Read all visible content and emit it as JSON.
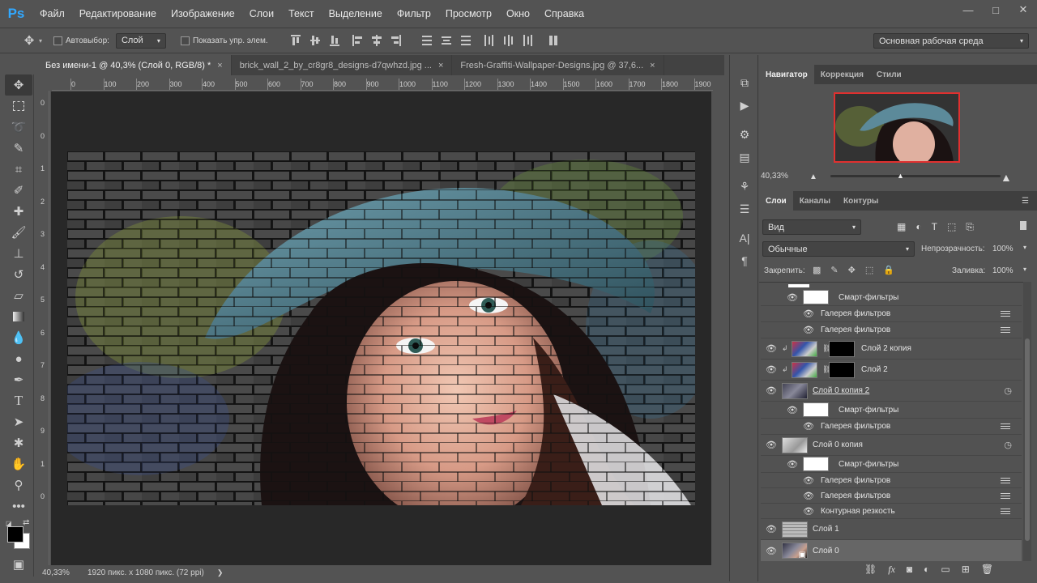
{
  "app": {
    "logo": "Ps"
  },
  "menu": [
    "Файл",
    "Редактирование",
    "Изображение",
    "Слои",
    "Текст",
    "Выделение",
    "Фильтр",
    "Просмотр",
    "Окно",
    "Справка"
  ],
  "window_controls": {
    "minimize": "—",
    "restore": "□",
    "close": "✕"
  },
  "options": {
    "autoselect_label": "Автовыбор:",
    "autoselect_value": "Слой",
    "show_controls_label": "Показать упр. элем.",
    "workspace": "Основная рабочая среда"
  },
  "doc_tabs": [
    {
      "label": "Без имени-1 @ 40,3% (Слой 0, RGB/8) *",
      "close": "×"
    },
    {
      "label": "brick_wall_2_by_cr8gr8_designs-d7qwhzd.jpg ...",
      "close": "×"
    },
    {
      "label": "Fresh-Graffiti-Wallpaper-Designs.jpg @ 37,6...",
      "close": "×"
    }
  ],
  "ruler": {
    "h_labels": [
      "0",
      "100",
      "200",
      "300",
      "400",
      "500",
      "600",
      "700",
      "800",
      "900",
      "1000",
      "1100",
      "1200",
      "1300",
      "1400",
      "1500",
      "1600",
      "1700",
      "1800",
      "1900"
    ],
    "v_labels": [
      "0",
      "0",
      "1",
      "2",
      "3",
      "4",
      "5",
      "6",
      "7",
      "8",
      "9",
      "1",
      "0"
    ]
  },
  "status": {
    "zoom": "40,33%",
    "info": "1920 пикс. x 1080 пикс. (72 ppi)",
    "arrow": "❯"
  },
  "navigator": {
    "tabs": [
      "Навигатор",
      "Коррекция",
      "Стили"
    ],
    "zoom": "40,33%"
  },
  "layers_panel": {
    "tabs": [
      "Слои",
      "Каналы",
      "Контуры"
    ],
    "filter": "Вид",
    "blend_mode": "Обычные",
    "opacity_label": "Непрозрачность:",
    "opacity_value": "100%",
    "lock_label": "Закрепить:",
    "fill_label": "Заливка:",
    "fill_value": "100%"
  },
  "layers": [
    {
      "kind": "smart",
      "label": "Смарт-фильтры"
    },
    {
      "kind": "filter",
      "label": "Галерея фильтров"
    },
    {
      "kind": "filter",
      "label": "Галерея фильтров"
    },
    {
      "kind": "layer",
      "label": "Слой 2 копия"
    },
    {
      "kind": "layer",
      "label": "Слой 2"
    },
    {
      "kind": "layer",
      "label": "Слой 0 копия 2"
    },
    {
      "kind": "smart",
      "label": "Смарт-фильтры"
    },
    {
      "kind": "filter",
      "label": "Галерея фильтров"
    },
    {
      "kind": "layer",
      "label": "Слой 0 копия"
    },
    {
      "kind": "smart",
      "label": "Смарт-фильтры"
    },
    {
      "kind": "filter",
      "label": "Галерея фильтров"
    },
    {
      "kind": "filter",
      "label": "Галерея фильтров"
    },
    {
      "kind": "filter",
      "label": "Контурная резкость"
    },
    {
      "kind": "layer",
      "label": "Слой 1"
    },
    {
      "kind": "layer",
      "label": "Слой 0"
    }
  ],
  "layer_footer_icons": [
    "link-icon",
    "fx-icon",
    "mask-icon",
    "adjustment-icon",
    "group-icon",
    "new-layer-icon",
    "trash-icon"
  ],
  "toolbar_icons": [
    "move-icon",
    "marquee-icon",
    "lasso-icon",
    "quick-select-icon",
    "crop-icon",
    "eyedropper-icon",
    "healing-icon",
    "brush-icon",
    "stamp-icon",
    "history-brush-icon",
    "eraser-icon",
    "gradient-icon",
    "blur-icon",
    "dodge-icon",
    "pen-icon",
    "type-icon",
    "path-select-icon",
    "shape-icon",
    "hand-icon",
    "zoom-icon",
    "more-icon"
  ]
}
